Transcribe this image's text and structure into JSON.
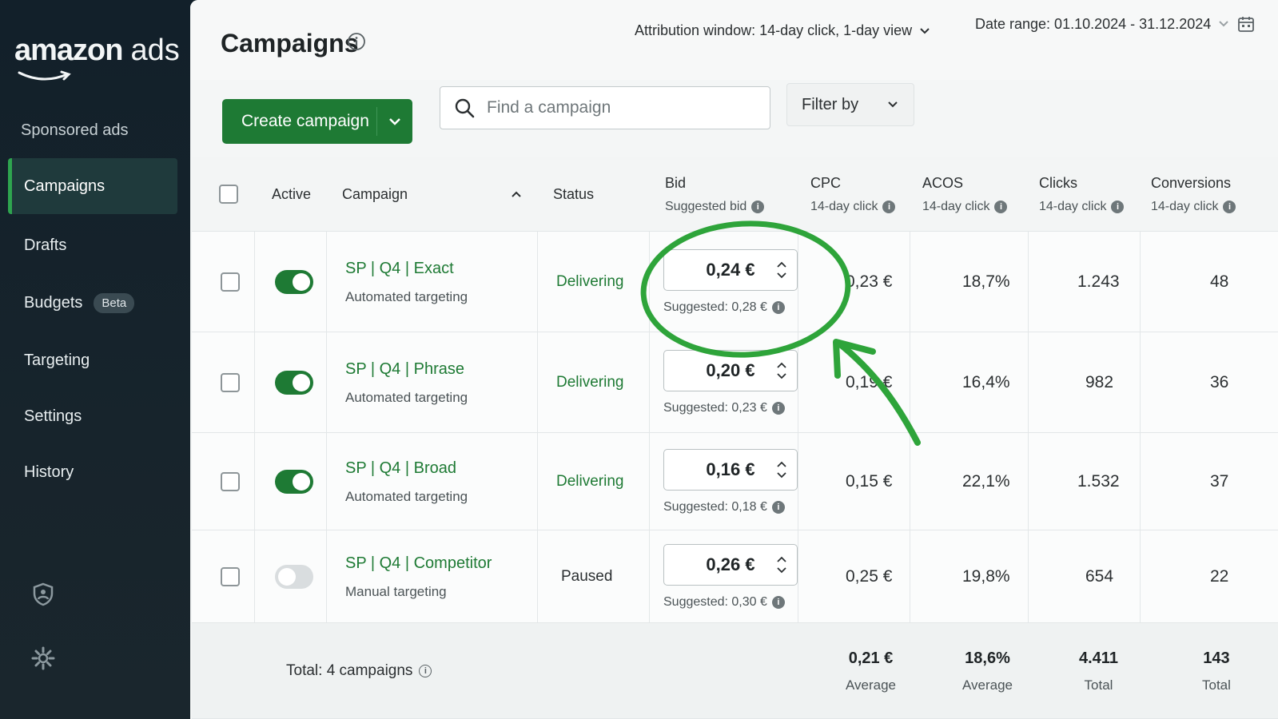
{
  "brand": {
    "wordmark": "amazon",
    "suffix": "ads"
  },
  "sidebar": {
    "section": "Sponsored ads",
    "items": [
      {
        "label": "Campaigns",
        "active": true
      },
      {
        "label": "Drafts"
      },
      {
        "label": "Budgets",
        "badge": "Beta"
      },
      {
        "label": "Targeting"
      },
      {
        "label": "Settings"
      },
      {
        "label": "History"
      }
    ],
    "bottom_icons": [
      "shield-icon",
      "gear-icon"
    ]
  },
  "header": {
    "title": "Campaigns",
    "attribution": "Attribution window: 14-day click, 1-day view",
    "date_range": "Date range: 01.10.2024 - 31.12.2024"
  },
  "toolbar": {
    "create_label": "Create campaign",
    "search_placeholder": "Find a campaign",
    "filter_label": "Filter by"
  },
  "table": {
    "columns": {
      "active": "Active",
      "campaign": "Campaign",
      "status": "Status",
      "bid": "Bid",
      "bid_sub": "Suggested bid",
      "cpc": "CPC",
      "cpc_sub": "14-day click",
      "acos": "ACOS",
      "acos_sub": "14-day click",
      "clicks": "Clicks",
      "clicks_sub": "14-day click",
      "conversions": "Conversions",
      "conversions_sub": "14-day click"
    },
    "rows": [
      {
        "name": "SP | Q4 | Exact",
        "targeting": "Automated targeting",
        "status": "Delivering",
        "active": true,
        "bid": "0,24 €",
        "suggested": "Suggested: 0,28 €",
        "cpc": "0,23 €",
        "acos": "18,7%",
        "clicks": "1.243",
        "conversions": "48"
      },
      {
        "name": "SP | Q4 | Phrase",
        "targeting": "Automated targeting",
        "status": "Delivering",
        "active": true,
        "bid": "0,20 €",
        "suggested": "Suggested: 0,23 €",
        "cpc": "0,19 €",
        "acos": "16,4%",
        "clicks": "982",
        "conversions": "36"
      },
      {
        "name": "SP | Q4 | Broad",
        "targeting": "Automated targeting",
        "status": "Delivering",
        "active": true,
        "bid": "0,16 €",
        "suggested": "Suggested: 0,18 €",
        "cpc": "0,15 €",
        "acos": "22,1%",
        "clicks": "1.532",
        "conversions": "37"
      },
      {
        "name": "SP | Q4 | Competitor",
        "targeting": "Manual targeting",
        "status": "Paused",
        "active": false,
        "bid": "0,26 €",
        "suggested": "Suggested: 0,30 €",
        "cpc": "0,25 €",
        "acos": "19,8%",
        "clicks": "654",
        "conversions": "22"
      }
    ],
    "totals": {
      "label": "Total: 4 campaigns",
      "cpc": "0,21 €",
      "cpc_sub": "Average",
      "acos": "18,6%",
      "acos_sub": "Average",
      "clicks": "4.411",
      "clicks_sub": "Total",
      "conversions": "143",
      "conversions_sub": "Total"
    }
  },
  "colors": {
    "brand_green": "#1e7a34",
    "sidebar_bg": "#12202a",
    "annotation_green": "#2ea43a"
  }
}
